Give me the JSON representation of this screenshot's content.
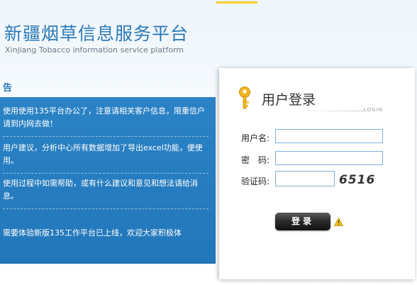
{
  "header": {
    "title_cn": "新疆烟草信息服务平台",
    "title_en": "Xinjiang Tobacco  information service platform"
  },
  "notice": {
    "heading": "告",
    "items": [
      "使用使用135平台办公了，注意请相关客户信息，限重信户请到内网去做！",
      "用户建议，分析中心所有数据增加了导出excel功能，便使用。",
      "使用过程中如需帮助，或有什么建议和意见和想法请给消息。",
      "需要体验新版135工作平台已上线，欢迎大家积极体"
    ]
  },
  "login": {
    "title": "用户登录",
    "subtitle": "LOGIN",
    "username_label": "用户名:",
    "password_label": "密　码:",
    "captcha_label": "验证码:",
    "username_value": "",
    "password_value": "",
    "captcha_value": "",
    "captcha_code": "6516",
    "submit_label": "登录"
  },
  "icons": {
    "key": "key-icon",
    "warning": "warning-icon"
  },
  "colors": {
    "brand_blue": "#2d79b7",
    "panel_blue": "#2277b9",
    "accent_yellow": "#f4cf2a"
  }
}
